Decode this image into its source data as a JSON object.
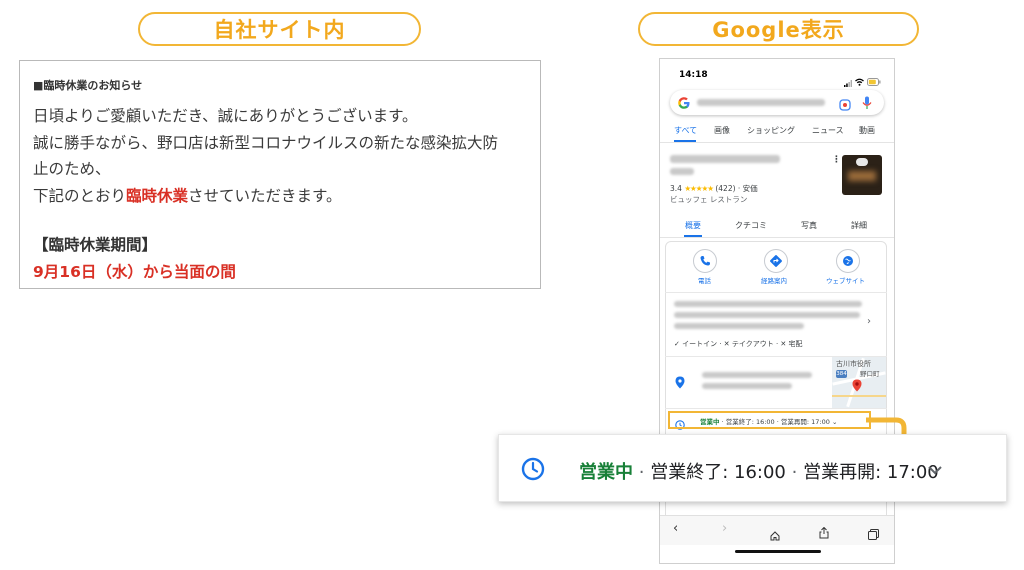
{
  "labels": {
    "own_site": "自社サイト内",
    "google": "Google表示"
  },
  "notice": {
    "heading": "■臨時休業のお知らせ",
    "line1": "日頃よりご愛顧いただき、誠にありがとうございます。",
    "line2a": "誠に勝手ながら、野口店は新型コロナウイルスの新たな感染拡大防",
    "line2b": "止のため、",
    "line3_pre": "下記のとおり",
    "line3_red": "臨時休業",
    "line3_post": "させていただきます。",
    "period_title": "【臨時休業期間】",
    "period_value": "9月16日（水）から当面の間"
  },
  "phone": {
    "time": "14:18",
    "tabs": [
      "すべて",
      "画像",
      "ショッピング",
      "ニュース",
      "動画"
    ],
    "rating": "3.4",
    "stars": "★★★★★",
    "reviews": "(422)",
    "price": "· 安価",
    "category": "ビュッフェ レストラン",
    "sub_tabs": [
      "概要",
      "クチコミ",
      "写真",
      "詳細"
    ],
    "actions": [
      "電話",
      "経路案内",
      "ウェブサイト"
    ],
    "service_dine": "✓ イートイン",
    "service_takeout": "✕ テイクアウト",
    "service_delivery": "✕ 宅配",
    "map_label1": "古川市役所",
    "map_label2": "野口町",
    "map_route": "384",
    "hours_open": "営業中",
    "hours_close": "営業終了: 16:00",
    "hours_reopen": "営業再開: 17:00"
  },
  "zoom": {
    "open": "営業中",
    "close": "営業終了: 16:00",
    "reopen": "営業再開: 17:00"
  },
  "colors": {
    "accent": "#f2b635",
    "red": "#d93025",
    "green": "#188038",
    "google_blue": "#1a73e8"
  }
}
